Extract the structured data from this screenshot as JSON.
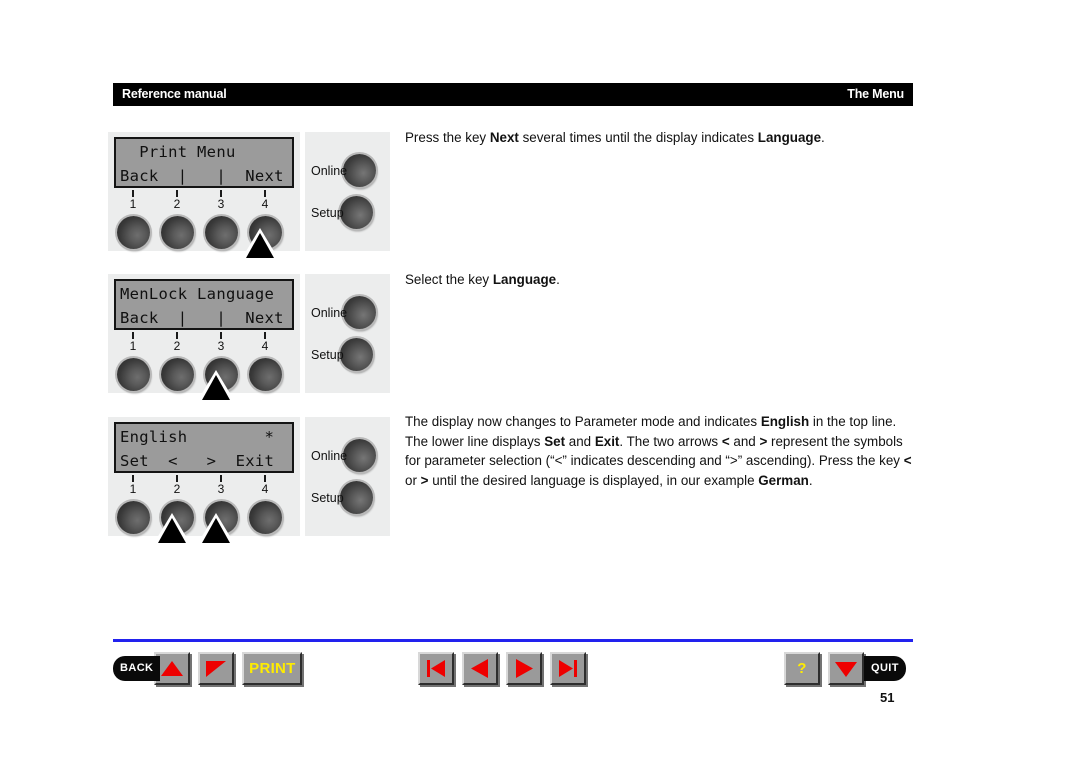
{
  "header": {
    "left_title": "Reference manual",
    "right_title": "The Menu",
    "background_color": "#000000",
    "text_color": "#ffffff"
  },
  "steps": [
    {
      "panel": {
        "lcd": {
          "line1": "  Print Menu",
          "line2": "Back  |   |  Next"
        },
        "key_numbers": [
          "1",
          "2",
          "3",
          "4"
        ],
        "pointer_key": 4,
        "side_buttons": [
          {
            "label": "Online",
            "name": "online-button"
          },
          {
            "label": "Setup",
            "name": "setup-button"
          }
        ]
      },
      "text_html": "Press the key <b>Next</b> several times until the display indicates <b>Language</b>."
    },
    {
      "panel": {
        "lcd": {
          "line1": "MenLock Language",
          "line2": "Back  |   |  Next"
        },
        "key_numbers": [
          "1",
          "2",
          "3",
          "4"
        ],
        "pointer_key": 3,
        "side_buttons": [
          {
            "label": "Online",
            "name": "online-button"
          },
          {
            "label": "Setup",
            "name": "setup-button"
          }
        ]
      },
      "text_html": "Select the key <b>Language</b>."
    },
    {
      "panel": {
        "lcd": {
          "line1": "English        *",
          "line2": "Set  <   >  Exit"
        },
        "key_numbers": [
          "1",
          "2",
          "3",
          "4"
        ],
        "pointer_key": 23,
        "side_buttons": [
          {
            "label": "Online",
            "name": "online-button"
          },
          {
            "label": "Setup",
            "name": "setup-button"
          }
        ]
      },
      "text_html": "The display now changes to Parameter mode and indicates <b>English</b> in the top line.<br>The lower line displays <b>Set</b> and <b>Exit</b>. The two arrows <b>&lt;</b> and <b>&gt;</b> represent the symbols for parameter selection (“&lt;” indicates descending and “&gt;” ascending). Press the key <b>&lt;</b> or <b>&gt;</b> until the desired language is displayed, in our example <b>German</b>."
    }
  ],
  "toolbar": {
    "rule_color": "#2222ee",
    "left": {
      "back_label": "BACK",
      "up_icon": "triangle-up-icon",
      "down_icon": "triangle-down-left-icon",
      "print_label": "PRINT"
    },
    "center": {
      "first_icon": "skip-first-icon",
      "prev_icon": "triangle-left-icon",
      "next_icon": "triangle-right-icon",
      "last_icon": "skip-last-icon"
    },
    "right": {
      "help_label": "?",
      "down_icon": "triangle-down-icon",
      "quit_label": "QUIT"
    },
    "accent_red": "#ee0000",
    "accent_yellow": "#ffec00"
  },
  "page_number": "51"
}
